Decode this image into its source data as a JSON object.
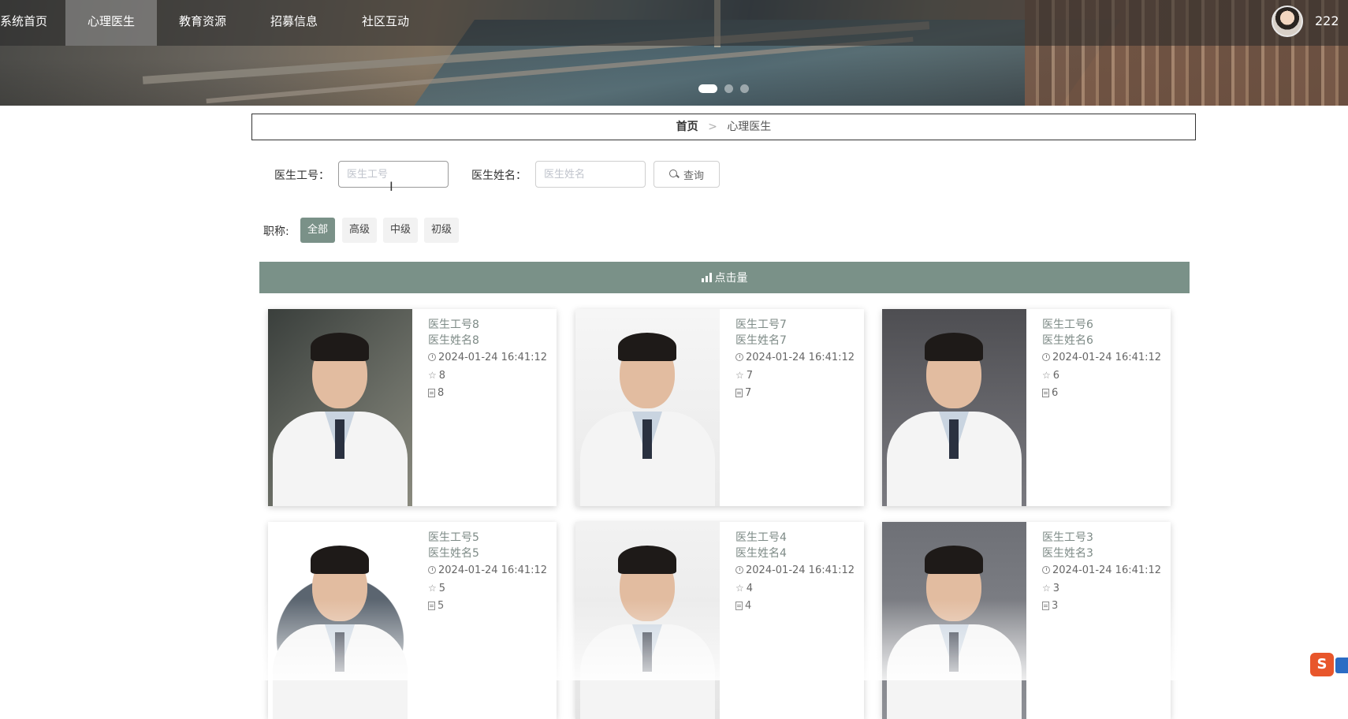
{
  "nav": {
    "items": [
      {
        "label": "系统首页",
        "active": false
      },
      {
        "label": "心理医生",
        "active": true
      },
      {
        "label": "教育资源",
        "active": false
      },
      {
        "label": "招募信息",
        "active": false
      },
      {
        "label": "社区互动",
        "active": false
      }
    ],
    "username": "222"
  },
  "carousel": {
    "slide_count": 3,
    "active_index": 0
  },
  "breadcrumb": {
    "home": "首页",
    "separator": ">",
    "current": "心理医生"
  },
  "search": {
    "id_label": "医生工号：",
    "id_placeholder": "医生工号",
    "id_value": "",
    "name_label": "医生姓名：",
    "name_placeholder": "医生姓名",
    "name_value": "",
    "query_label": "查询"
  },
  "filter": {
    "label": "职称:",
    "options": [
      {
        "label": "全部",
        "active": true
      },
      {
        "label": "高级",
        "active": false
      },
      {
        "label": "中级",
        "active": false
      },
      {
        "label": "初级",
        "active": false
      }
    ]
  },
  "sort": {
    "label": "点击量"
  },
  "theme": {
    "accent": "#7a9188",
    "nav_bg": "rgba(40,40,40,0.55)"
  },
  "doctors": [
    {
      "id": "医生工号8",
      "name": "医生姓名8",
      "time": "2024-01-24 16:41:12",
      "stars": "8",
      "clicks": "8"
    },
    {
      "id": "医生工号7",
      "name": "医生姓名7",
      "time": "2024-01-24 16:41:12",
      "stars": "7",
      "clicks": "7"
    },
    {
      "id": "医生工号6",
      "name": "医生姓名6",
      "time": "2024-01-24 16:41:12",
      "stars": "6",
      "clicks": "6"
    },
    {
      "id": "医生工号5",
      "name": "医生姓名5",
      "time": "2024-01-24 16:41:12",
      "stars": "5",
      "clicks": "5"
    },
    {
      "id": "医生工号4",
      "name": "医生姓名4",
      "time": "2024-01-24 16:41:12",
      "stars": "4",
      "clicks": "4"
    },
    {
      "id": "医生工号3",
      "name": "医生姓名3",
      "time": "2024-01-24 16:41:12",
      "stars": "3",
      "clicks": "3"
    }
  ]
}
